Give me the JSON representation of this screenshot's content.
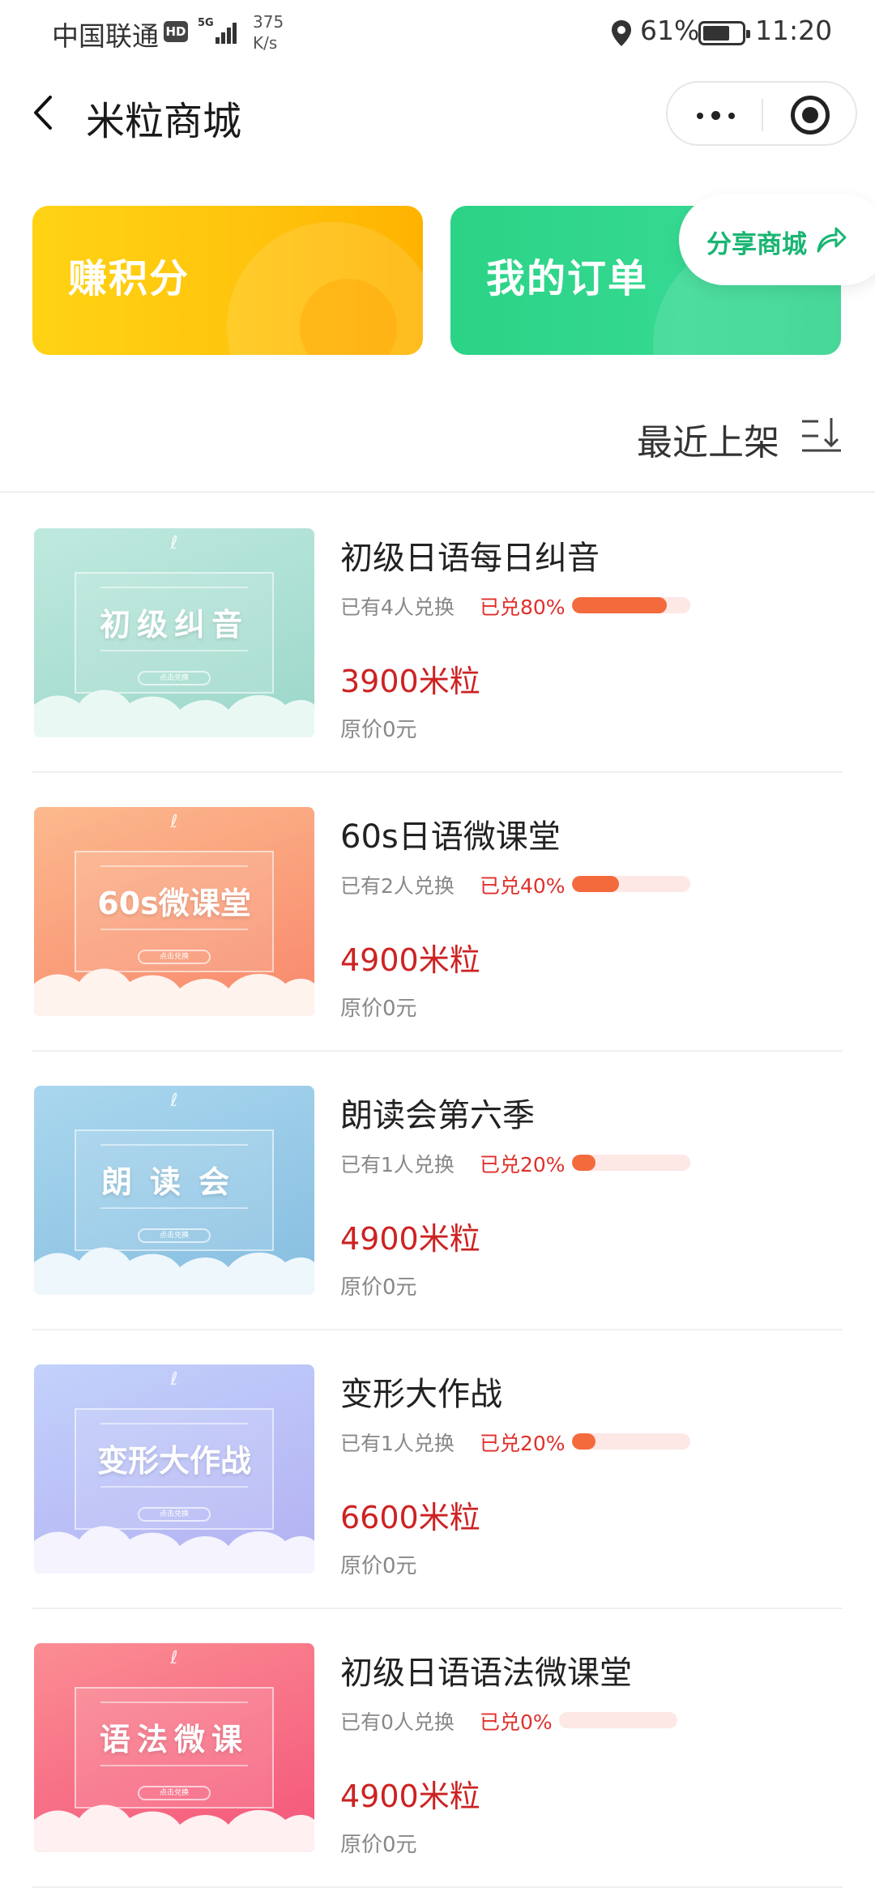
{
  "status_bar": {
    "carrier": "中国联通",
    "hd": "HD",
    "network": "5G",
    "speed_value": "375",
    "speed_unit": "K/s",
    "battery": "61%",
    "time": "11:20"
  },
  "nav": {
    "title": "米粒商城"
  },
  "cards": {
    "earn_label": "赚积分",
    "order_label": "我的订单",
    "share_label": "分享商城"
  },
  "sort": {
    "label": "最近上架"
  },
  "colors": {
    "price_red": "#cd2222",
    "progress_orange": "#f36a3c",
    "share_green": "#19b572",
    "earn_yellow": "#ffc40d",
    "order_green": "#2ed28a"
  },
  "products": [
    {
      "name": "初级日语每日纠音",
      "thumb_title": "初级纠音",
      "thumb_button": "点击兑换",
      "exchanged": "已有4人兑换",
      "rate_label": "已兑80%",
      "progress": 0.8,
      "price": "3900米粒",
      "original": "原价0元",
      "bg_from": "#bfe9df",
      "bg_to": "#9bd7c9",
      "cloud": "#eaf8f4"
    },
    {
      "name": "60s日语微课堂",
      "thumb_title": "60s微课堂",
      "thumb_button": "点击兑换",
      "exchanged": "已有2人兑换",
      "rate_label": "已兑40%",
      "progress": 0.4,
      "price": "4900米粒",
      "original": "原价0元",
      "bg_from": "#fcb98d",
      "bg_to": "#f8876b",
      "cloud": "#fff3ee"
    },
    {
      "name": "朗读会第六季",
      "thumb_title": "朗读会",
      "thumb_button": "点击兑换",
      "exchanged": "已有1人兑换",
      "rate_label": "已兑20%",
      "progress": 0.2,
      "price": "4900米粒",
      "original": "原价0元",
      "bg_from": "#a9d7ee",
      "bg_to": "#86bde0",
      "cloud": "#eef7fc"
    },
    {
      "name": "变形大作战",
      "thumb_title": "变形大作战",
      "thumb_button": "点击兑换",
      "exchanged": "已有1人兑换",
      "rate_label": "已兑20%",
      "progress": 0.2,
      "price": "6600米粒",
      "original": "原价0元",
      "bg_from": "#c2d1fb",
      "bg_to": "#b3b0f2",
      "cloud": "#f4f3fe"
    },
    {
      "name": "初级日语语法微课堂",
      "thumb_title": "语法微课",
      "thumb_button": "点击兑换",
      "exchanged": "已有0人兑换",
      "rate_label": "已兑0%",
      "progress": 0.0,
      "price": "4900米粒",
      "original": "原价0元",
      "bg_from": "#fb8d93",
      "bg_to": "#f4557a",
      "cloud": "#fff0f2"
    }
  ]
}
